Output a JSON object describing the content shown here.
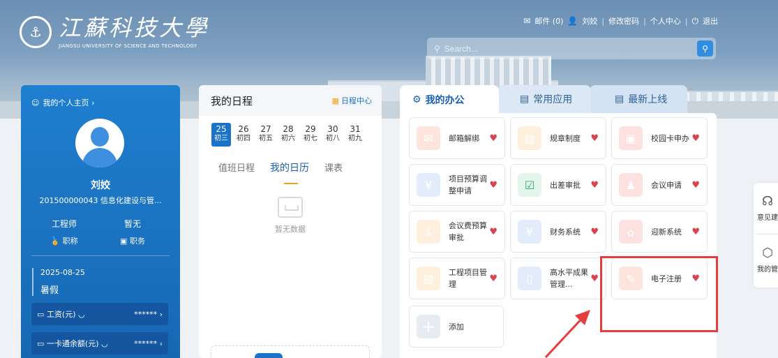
{
  "header": {
    "logo_cn": "江蘇科技大學",
    "logo_en": "JIANGSU UNIVERSITY OF SCIENCE AND TECHNOLOGY",
    "mail": "邮件 (0)",
    "user": "刘姣",
    "change_password": "修改密码",
    "personal_center": "个人中心",
    "logout": "退出",
    "search_placeholder": "Search..."
  },
  "profile": {
    "home_link": "我的个人主页 ›",
    "name": "刘姣",
    "id_dept": "201500000043  信息化建设与管...",
    "title_value": "工程师",
    "title_label": "职称",
    "post_value": "暂无",
    "post_label": "职务",
    "date": "2025-08-25",
    "season": "暑假",
    "salary_label": "工资(元)",
    "salary_value": "******",
    "card_label": "一卡通余额(元)",
    "card_value": "******"
  },
  "schedule": {
    "title": "我的日程",
    "center_link": "日程中心",
    "days": [
      {
        "n": "25",
        "l": "初三",
        "active": true
      },
      {
        "n": "26",
        "l": "初四"
      },
      {
        "n": "27",
        "l": "初五"
      },
      {
        "n": "28",
        "l": "初六"
      },
      {
        "n": "29",
        "l": "初七"
      },
      {
        "n": "30",
        "l": "初八"
      },
      {
        "n": "31",
        "l": "初九"
      }
    ],
    "tabs": [
      "值班日程",
      "我的日历",
      "课表"
    ],
    "empty_text": "暂无数据"
  },
  "office": {
    "tabs": [
      "我的办公",
      "常用应用",
      "最新上线"
    ],
    "apps": [
      {
        "name": "邮箱解绑",
        "icon": "mail-icon"
      },
      {
        "name": "规章制度",
        "icon": "document-icon"
      },
      {
        "name": "校园卡申办",
        "icon": "card-icon"
      },
      {
        "name": "项目预算调整申请",
        "icon": "budget-icon"
      },
      {
        "name": "出差审批",
        "icon": "checklist-icon"
      },
      {
        "name": "会议申请",
        "icon": "meeting-icon"
      },
      {
        "name": "会议费预算审批",
        "icon": "money-icon"
      },
      {
        "name": "财务系统",
        "icon": "finance-icon"
      },
      {
        "name": "迎新系统",
        "icon": "house-icon"
      },
      {
        "name": "工程项目管理",
        "icon": "project-icon"
      },
      {
        "name": "高水平成果管理...",
        "icon": "book-icon"
      },
      {
        "name": "电子注册",
        "icon": "edit-doc-icon"
      }
    ],
    "add_label": "添加"
  },
  "side": {
    "feedback": "意见建",
    "mine": "我的管"
  },
  "colors": {
    "primary": "#1a73c9",
    "highlight": "#e53c3c",
    "heart": "#d9434b"
  }
}
